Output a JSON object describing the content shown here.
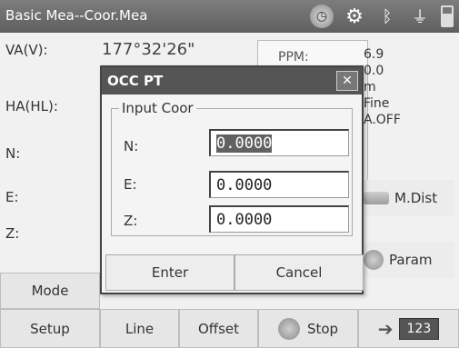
{
  "title_bar": {
    "title": "Basic Mea--Coor.Mea",
    "icons": [
      "timer-icon",
      "gear-icon",
      "bluetooth-icon",
      "plug-icon",
      "battery-icon"
    ]
  },
  "fields": {
    "va_label": "VA(V):",
    "ha_label": "HA(HL):",
    "n_label": "N:",
    "e_label": "E:",
    "z_label": "Z:",
    "va_value": "177°32'26\""
  },
  "info_panel": {
    "ppm_label": "PPM:",
    "lines": [
      "6.9",
      "0.0",
      "m",
      "Fine",
      "A.OFF"
    ]
  },
  "right_buttons": {
    "mdist_label": "M.Dist",
    "param_label": "Param",
    "stop_label": "Stop",
    "keyboard_label": "123"
  },
  "bottom_buttons": {
    "mode": "Mode",
    "setup": "Setup",
    "line": "Line",
    "offset": "Offset"
  },
  "dialog": {
    "title": "OCC PT",
    "close_symbol": "✕",
    "group_label": "Input Coor",
    "n_label": "N:",
    "n_value": "0.0000",
    "e_label": "E:",
    "e_value": "0.0000",
    "z_label": "Z:",
    "z_value": "0.0000",
    "enter_label": "Enter",
    "cancel_label": "Cancel"
  },
  "colors": {
    "titlebar": "#666666",
    "dialog_title": "#555555",
    "selection": "#616161"
  }
}
